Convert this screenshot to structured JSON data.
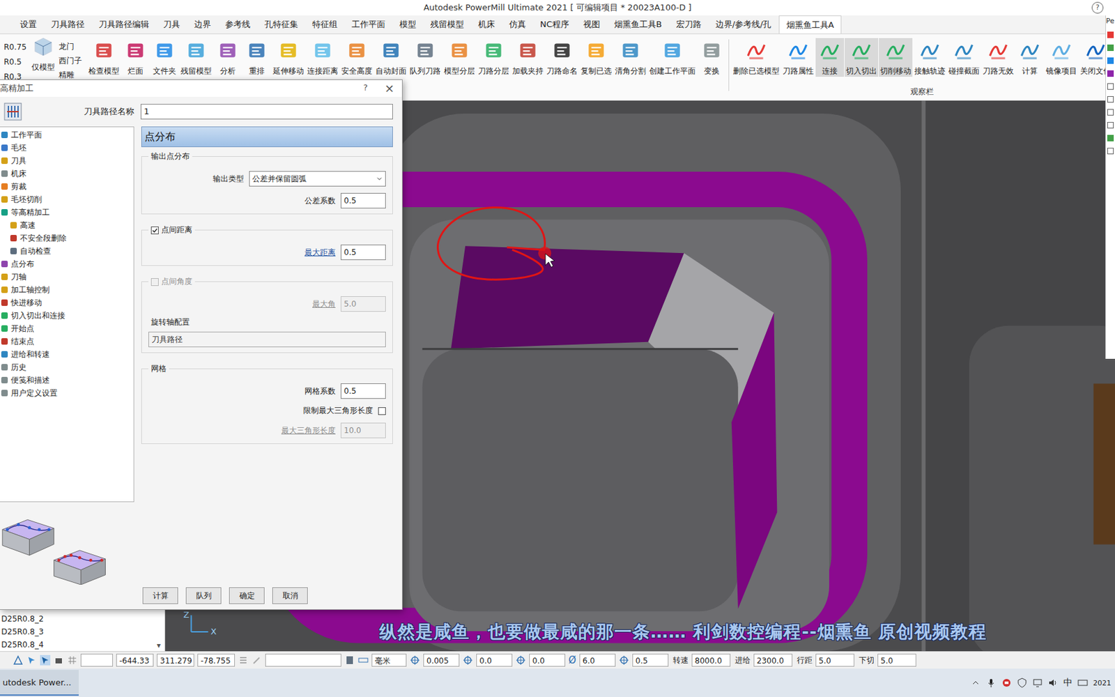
{
  "window": {
    "title": "Autodesk PowerMill Ultimate 2021   [ 可编辑项目 * 20023A100-D ]",
    "help": "?"
  },
  "menu_tabs": [
    {
      "label": "设置",
      "selected": false
    },
    {
      "label": "刀具路径",
      "selected": false
    },
    {
      "label": "刀具路径编辑",
      "selected": false
    },
    {
      "label": "刀具",
      "selected": false
    },
    {
      "label": "边界",
      "selected": false
    },
    {
      "label": "参考线",
      "selected": false
    },
    {
      "label": "孔特征集",
      "selected": false
    },
    {
      "label": "特征组",
      "selected": false
    },
    {
      "label": "工作平面",
      "selected": false
    },
    {
      "label": "模型",
      "selected": false
    },
    {
      "label": "残留模型",
      "selected": false
    },
    {
      "label": "机床",
      "selected": false
    },
    {
      "label": "仿真",
      "selected": false
    },
    {
      "label": "NC程序",
      "selected": false
    },
    {
      "label": "视图",
      "selected": false
    },
    {
      "label": "烟熏鱼工具B",
      "selected": false
    },
    {
      "label": "宏刀路",
      "selected": false
    },
    {
      "label": "边界/参考线/孔",
      "selected": false
    },
    {
      "label": "烟熏鱼工具A",
      "selected": true
    }
  ],
  "side_panel_title": "Pe",
  "ribbon": {
    "radii": [
      "R0.75",
      "R0.5",
      "R0.3"
    ],
    "model_button": {
      "label": "仅模型",
      "color": "#4a90c8"
    },
    "machines": [
      "龙门",
      "西门子",
      "精雕"
    ],
    "group1": [
      {
        "label": "检查模型",
        "color": "#d32f2f",
        "highlighted": false
      },
      {
        "label": "烂面",
        "color": "#c2185b",
        "highlighted": false
      },
      {
        "label": "文件夹",
        "color": "#1e88e5",
        "highlighted": false
      },
      {
        "label": "残留模型",
        "color": "#3aa0d8",
        "highlighted": false
      },
      {
        "label": "分析",
        "color": "#8e44ad",
        "highlighted": false
      },
      {
        "label": "重排",
        "color": "#2a6fb0",
        "highlighted": false
      },
      {
        "label": "延伸移动",
        "color": "#e0b000",
        "highlighted": false
      },
      {
        "label": "连接距离",
        "color": "#5bbbe8",
        "highlighted": false
      },
      {
        "label": "安全高度",
        "color": "#e67e22",
        "highlighted": false
      },
      {
        "label": "自动封面",
        "color": "#1e6fb0",
        "highlighted": false
      },
      {
        "label": "队列刀路",
        "color": "#5d6d7e",
        "highlighted": false
      },
      {
        "label": "模型分层",
        "color": "#e67e22",
        "highlighted": false
      },
      {
        "label": "刀路分层",
        "color": "#27ae60",
        "highlighted": false
      },
      {
        "label": "加载夹持",
        "color": "#c0392b",
        "highlighted": false
      },
      {
        "label": "刀路命名",
        "color": "#222222",
        "highlighted": false
      },
      {
        "label": "复制已选",
        "color": "#f39c12",
        "highlighted": false
      },
      {
        "label": "清角分割",
        "color": "#2e86c1",
        "highlighted": false
      },
      {
        "label": "创建工作平面",
        "color": "#3498db",
        "highlighted": false
      },
      {
        "label": "变换",
        "color": "#7f8c8d",
        "highlighted": false
      }
    ],
    "group2": [
      {
        "label": "删除已选模型",
        "color": "#e53935",
        "highlighted": false
      },
      {
        "label": "刀路属性",
        "color": "#1e88e5",
        "highlighted": false
      },
      {
        "label": "连接",
        "color": "#27ae60",
        "highlighted": true
      },
      {
        "label": "切入切出",
        "color": "#27ae60",
        "highlighted": true
      },
      {
        "label": "切削移动",
        "color": "#27ae60",
        "highlighted": true
      },
      {
        "label": "接触轨迹",
        "color": "#2e86c1",
        "highlighted": false
      },
      {
        "label": "碰撞截面",
        "color": "#2e86c1",
        "highlighted": false
      },
      {
        "label": "刀路无效",
        "color": "#e53935",
        "highlighted": false
      },
      {
        "label": "计算",
        "color": "#2e86c1",
        "highlighted": false
      },
      {
        "label": "镜像项目",
        "color": "#5dade2",
        "highlighted": false
      },
      {
        "label": "关闭文件",
        "color": "#1565c0",
        "highlighted": false
      }
    ],
    "group2_label": "观察栏"
  },
  "dialog": {
    "title": "高精加工",
    "help": "?",
    "close": "×",
    "name_label": "刀具路径名称",
    "name_value": "1",
    "tree": [
      {
        "label": "工作平面",
        "depth": 0,
        "color": "#2e86c1"
      },
      {
        "label": "毛坯",
        "depth": 0,
        "color": "#3a78c8"
      },
      {
        "label": "刀具",
        "depth": 0,
        "color": "#d4a017"
      },
      {
        "label": "机床",
        "depth": 0,
        "color": "#7f8c8d"
      },
      {
        "label": "剪裁",
        "depth": 0,
        "color": "#e67e22"
      },
      {
        "label": "毛坯切削",
        "depth": 0,
        "color": "#d4a017"
      },
      {
        "label": "等高精加工",
        "depth": 0,
        "color": "#16a085"
      },
      {
        "label": "高速",
        "depth": 1,
        "color": "#d4a017"
      },
      {
        "label": "不安全段删除",
        "depth": 1,
        "color": "#c0392b"
      },
      {
        "label": "自动检查",
        "depth": 1,
        "color": "#5d6d7e"
      },
      {
        "label": "点分布",
        "depth": 0,
        "color": "#8e44ad"
      },
      {
        "label": "刀轴",
        "depth": 0,
        "color": "#d4a017"
      },
      {
        "label": "加工轴控制",
        "depth": 0,
        "color": "#d4a017"
      },
      {
        "label": "快进移动",
        "depth": 0,
        "color": "#c0392b"
      },
      {
        "label": "切入切出和连接",
        "depth": 0,
        "color": "#27ae60"
      },
      {
        "label": "开始点",
        "depth": 0,
        "color": "#27ae60"
      },
      {
        "label": "结束点",
        "depth": 0,
        "color": "#c0392b"
      },
      {
        "label": "进给和转速",
        "depth": 0,
        "color": "#2e86c1"
      },
      {
        "label": "历史",
        "depth": 0,
        "color": "#7f8c8d"
      },
      {
        "label": "便笺和描述",
        "depth": 0,
        "color": "#7f8c8d"
      },
      {
        "label": "用户定义设置",
        "depth": 0,
        "color": "#7f8c8d"
      }
    ],
    "panel_title": "点分布",
    "output_group": {
      "legend": "输出点分布",
      "type_label": "输出类型",
      "type_value": "公差并保留圆弧",
      "tol_label": "公差系数",
      "tol_value": "0.5"
    },
    "distance_group": {
      "legend": "点间距离",
      "checked": true,
      "disabled": false,
      "field_label": "最大距离",
      "field_value": "0.5"
    },
    "angle_group": {
      "legend": "点间角度",
      "checked": false,
      "disabled": true,
      "field_label": "最大角",
      "field_value": "5.0",
      "axis_label": "旋转轴配置",
      "axis_value": "刀具路径"
    },
    "mesh_group": {
      "legend": "网格",
      "factor_label": "网格系数",
      "factor_value": "0.5",
      "limit_label": "限制最大三角形长度",
      "limit_checked": false,
      "max_label": "最大三角形长度",
      "max_value": "10.0",
      "max_disabled": true
    },
    "buttons": [
      "计算",
      "队列",
      "确定",
      "取消"
    ]
  },
  "explorer_items": [
    "D25R0.8_2",
    "D25R0.8_3",
    "D25R0.8_4"
  ],
  "explorer_scroll": "▾",
  "viewport": {
    "axes": [
      "Z",
      "X"
    ]
  },
  "watermark": "纵然是咸鱼，也要做最咸的那一条……   利剑数控编程--烟熏鱼 原创视频教程",
  "status_bar": {
    "coords": [
      "-644.33",
      "311.279",
      "-78.755"
    ],
    "units": "毫米",
    "params": [
      {
        "symbol": "",
        "value": "0.005"
      },
      {
        "symbol": "",
        "value": "0.0"
      },
      {
        "symbol": "",
        "value": "0.0"
      },
      {
        "symbol": "Ø",
        "value": "6.0"
      },
      {
        "symbol": "",
        "value": "0.5"
      }
    ],
    "feeds": [
      {
        "label": "转速",
        "value": "8000.0"
      },
      {
        "label": "进给",
        "value": "2300.0"
      },
      {
        "label": "行距",
        "value": "5.0"
      },
      {
        "label": "下切",
        "value": "5.0"
      }
    ]
  },
  "taskbar": {
    "app": "utodesk Power...",
    "ime": "中",
    "clock": "2021"
  }
}
